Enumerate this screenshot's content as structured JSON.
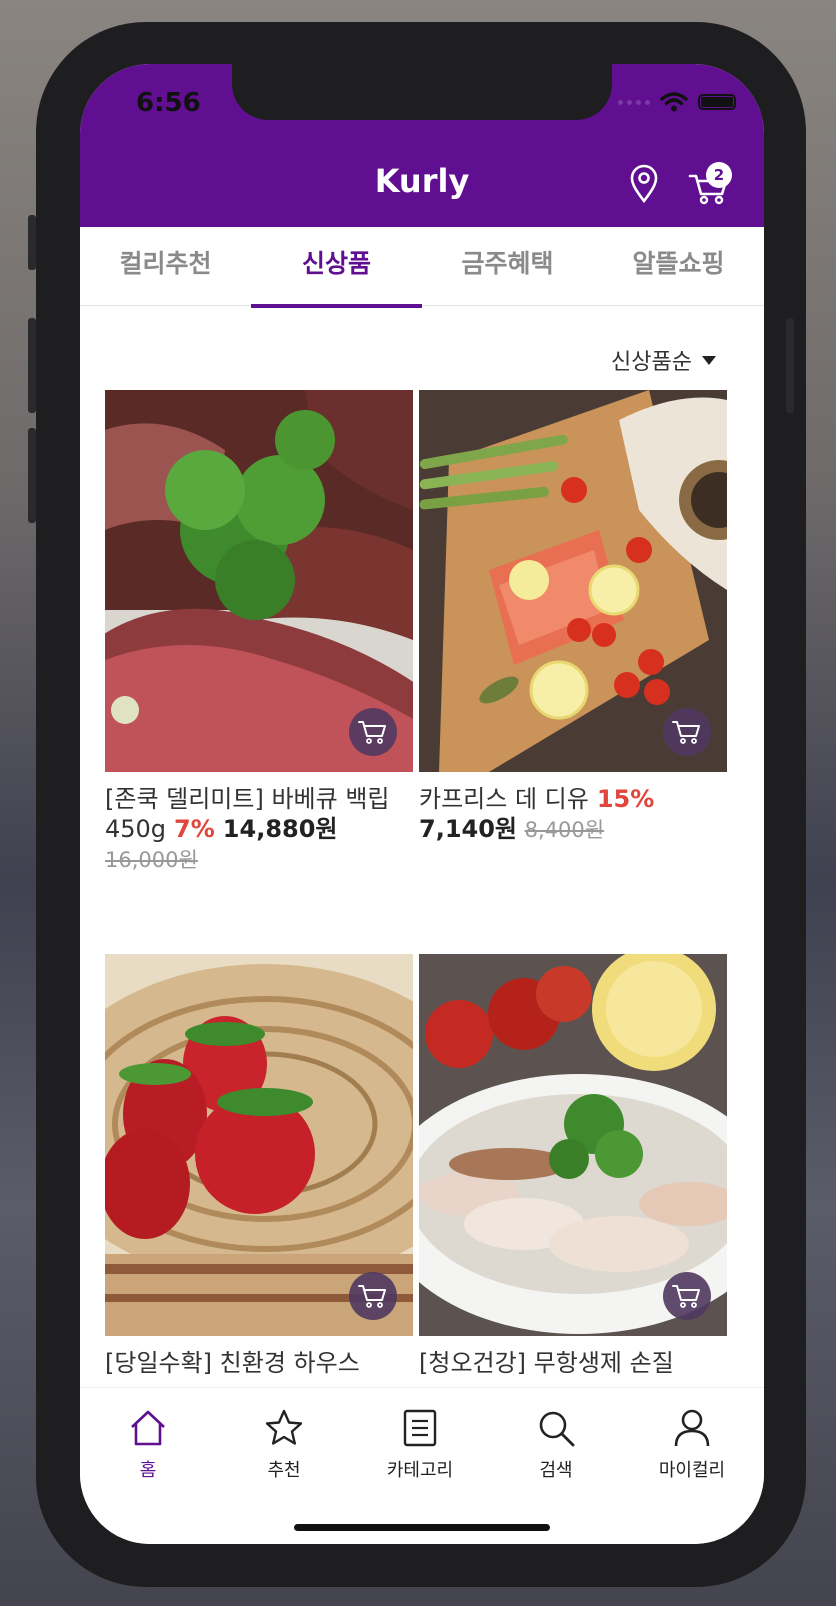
{
  "status": {
    "time": "6:56"
  },
  "header": {
    "title": "Kurly",
    "cart_count": "2"
  },
  "tabs": [
    {
      "label": "컬리추천",
      "active": false
    },
    {
      "label": "신상품",
      "active": true
    },
    {
      "label": "금주혜택",
      "active": false
    },
    {
      "label": "알뜰쇼핑",
      "active": false
    }
  ],
  "sort": {
    "label": "신상품순"
  },
  "products": [
    {
      "name": "[존쿡 델리미트] 바베큐 백립 450g",
      "discount": "7%",
      "price": "14,880원",
      "original_price": "16,000원",
      "image": "steak"
    },
    {
      "name": "카프리스 데 디유",
      "discount": "15%",
      "price": "7,140원",
      "original_price": "8,400원",
      "image": "salmon"
    },
    {
      "name": "[당일수확] 친환경 하우스",
      "discount": "",
      "price": "",
      "original_price": "",
      "image": "strawberry"
    },
    {
      "name": "[청오건강] 무항생제 손질",
      "discount": "",
      "price": "",
      "original_price": "",
      "image": "shrimp"
    }
  ],
  "bottom_nav": [
    {
      "label": "홈",
      "icon": "home-icon",
      "active": true
    },
    {
      "label": "추천",
      "icon": "star-icon",
      "active": false
    },
    {
      "label": "카테고리",
      "icon": "list-icon",
      "active": false
    },
    {
      "label": "검색",
      "icon": "search-icon",
      "active": false
    },
    {
      "label": "마이컬리",
      "icon": "user-icon",
      "active": false
    }
  ],
  "colors": {
    "brand": "#5f0f8f",
    "discount": "#e0463c"
  }
}
